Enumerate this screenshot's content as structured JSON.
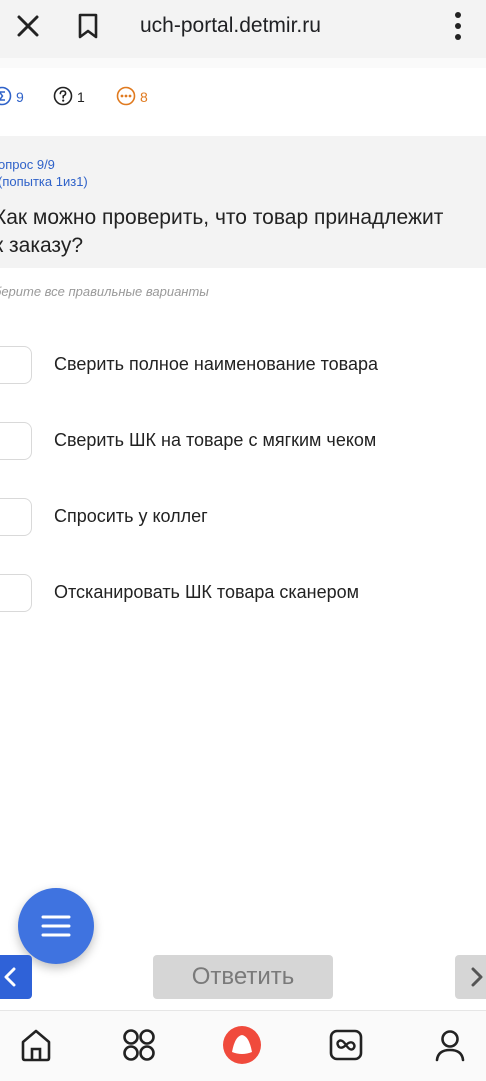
{
  "browser": {
    "url": "uch-portal.detmir.ru"
  },
  "stats": {
    "sigma_count": "9",
    "question_count": "1",
    "more_count": "8"
  },
  "question": {
    "number_label": "опрос 9/9",
    "attempt_label": "(попытка 1из1)",
    "text": "Как можно проверить, что товар принадлежит\nк заказу?",
    "hint": "берите все правильные варианты"
  },
  "options": [
    {
      "label": "Сверить полное наименование товара"
    },
    {
      "label": "Сверить ШК на товаре с мягким чеком"
    },
    {
      "label": "Спросить у коллег"
    },
    {
      "label": "Отсканировать ШК товара сканером"
    }
  ],
  "actions": {
    "answer_label": "Ответить"
  },
  "colors": {
    "accent": "#3f73e0",
    "link_blue": "#2f62c9",
    "orange": "#e07a1f"
  }
}
